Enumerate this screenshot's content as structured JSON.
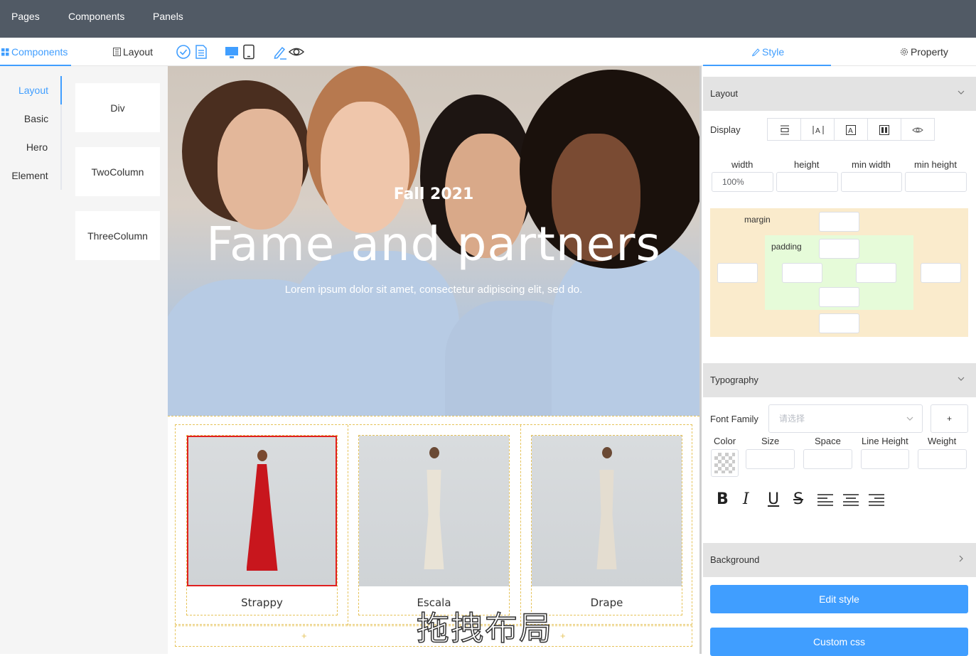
{
  "topbar": {
    "pages": "Pages",
    "components": "Components",
    "panels": "Panels"
  },
  "toolbar": {
    "components": "Components",
    "layout": "Layout",
    "style": "Style",
    "property": "Property"
  },
  "leftnav": {
    "items": [
      "Layout",
      "Basic",
      "Hero",
      "Element"
    ]
  },
  "components": [
    "Div",
    "TwoColumn",
    "ThreeColumn"
  ],
  "hero": {
    "subtitle": "Fall 2021",
    "title": "Fame and partners",
    "desc": "Lorem ipsum dolor sit amet, consectetur adipiscing elit, sed do."
  },
  "products": [
    {
      "name": "Strappy",
      "dress_color": "#c8161d"
    },
    {
      "name": "Escala",
      "dress_color": "#e9e3d6"
    },
    {
      "name": "Drape",
      "dress_color": "#e4ddd0"
    }
  ],
  "add_symbol": "+",
  "watermark": "拖拽布局",
  "style_panel": {
    "layout_title": "Layout",
    "display_label": "Display",
    "width_label": "width",
    "height_label": "height",
    "min_width_label": "min width",
    "min_height_label": "min height",
    "width_value": "100%",
    "margin_label": "margin",
    "padding_label": "padding",
    "typography_title": "Typography",
    "font_family_label": "Font Family",
    "font_family_placeholder": "请选择",
    "add_button": "+",
    "color_label": "Color",
    "size_label": "Size",
    "space_label": "Space",
    "line_height_label": "Line Height",
    "weight_label": "Weight",
    "format_buttons": [
      "B",
      "I",
      "U",
      "S"
    ],
    "background_title": "Background",
    "edit_style": "Edit style",
    "custom_css": "Custom css"
  },
  "colors": {
    "accent": "#409eff",
    "topbar": "#515a65",
    "margin_bg": "#faebcc",
    "padding_bg": "#e6fbd9",
    "selected_border": "#e01f1f",
    "guide": "#e6c35a"
  }
}
